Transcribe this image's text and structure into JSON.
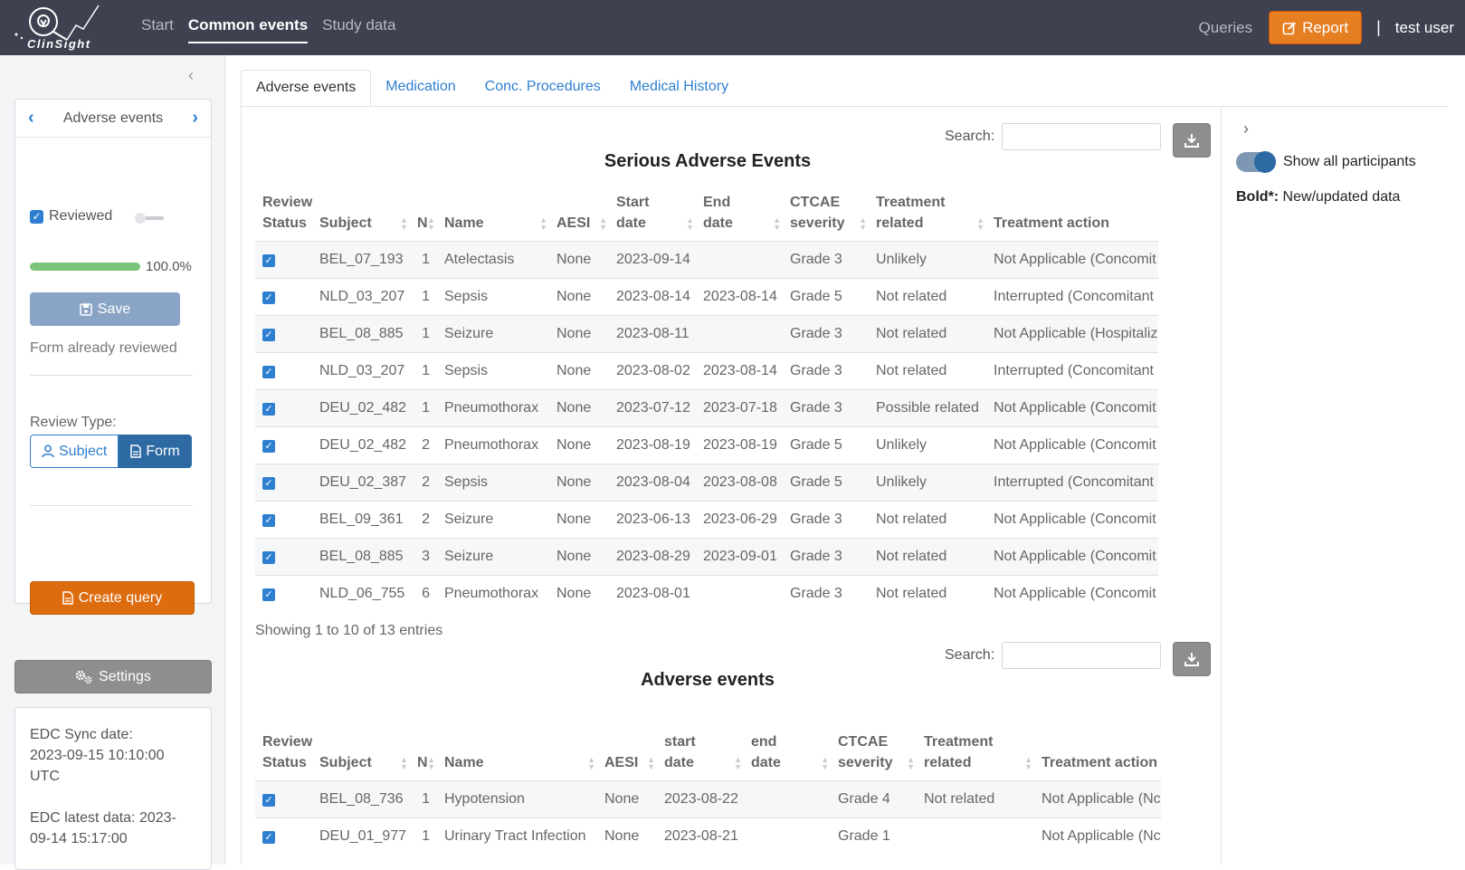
{
  "app": {
    "logo_text": "ClinSight"
  },
  "nav": {
    "links": [
      "Start",
      "Common events",
      "Study data"
    ],
    "active": "Common events",
    "queries": "Queries",
    "report": "Report",
    "separator": "|",
    "user": "test user"
  },
  "sidebar": {
    "form_name": "Adverse events",
    "reviewed_label": "Reviewed",
    "progress": 100,
    "progress_text": "100.0%",
    "save_label": "Save",
    "review_note": "Form already reviewed",
    "review_type_label": "Review Type:",
    "review_type_options": [
      "Subject",
      "Form"
    ],
    "review_type_selected": "Form",
    "create_query_label": "Create query",
    "settings_label": "Settings",
    "sync_date_label": "EDC Sync date:",
    "sync_date_value": "2023-09-15 10:10:00 UTC",
    "latest_data_label": "EDC latest data: 2023-",
    "latest_data_value": "09-14 15:17:00"
  },
  "tabs": [
    "Adverse events",
    "Medication",
    "Conc. Procedures",
    "Medical History"
  ],
  "right_panel": {
    "toggle_label": "Show all participants",
    "legend_bold": "Bold*:",
    "legend_text": " New/updated data"
  },
  "colors": {
    "navbar": "#3d4150",
    "accent": "#2f7fd0",
    "report": "#e67e22",
    "create_query": "#dd6c0f"
  },
  "sae_table": {
    "search_label": "Search:",
    "title": "Serious Adverse Events",
    "headers": [
      [
        "Review",
        "Status"
      ],
      [
        "",
        "Subject"
      ],
      [
        "",
        "N"
      ],
      [
        "",
        "Name"
      ],
      [
        "",
        "AESI"
      ],
      [
        "Start",
        "date"
      ],
      [
        "End",
        "date"
      ],
      [
        "CTCAE",
        "severity"
      ],
      [
        "Treatment",
        "related"
      ],
      [
        "",
        "Treatment action"
      ]
    ],
    "rows": [
      [
        "BEL_07_193",
        "1",
        "Atelectasis",
        "None",
        "2023-09-14",
        "",
        "Grade 3",
        "Unlikely",
        "Not Applicable (Concomit"
      ],
      [
        "NLD_03_207",
        "1",
        "Sepsis",
        "None",
        "2023-08-14",
        "2023-08-14",
        "Grade 5",
        "Not related",
        "Interrupted (Concomitant"
      ],
      [
        "BEL_08_885",
        "1",
        "Seizure",
        "None",
        "2023-08-11",
        "",
        "Grade 3",
        "Not related",
        "Not Applicable (Hospitaliz"
      ],
      [
        "NLD_03_207",
        "1",
        "Sepsis",
        "None",
        "2023-08-02",
        "2023-08-14",
        "Grade 3",
        "Not related",
        "Interrupted (Concomitant"
      ],
      [
        "DEU_02_482",
        "1",
        "Pneumothorax",
        "None",
        "2023-07-12",
        "2023-07-18",
        "Grade 3",
        "Possible related",
        "Not Applicable (Concomit"
      ],
      [
        "DEU_02_482",
        "2",
        "Pneumothorax",
        "None",
        "2023-08-19",
        "2023-08-19",
        "Grade 5",
        "Unlikely",
        "Not Applicable (Concomit"
      ],
      [
        "DEU_02_387",
        "2",
        "Sepsis",
        "None",
        "2023-08-04",
        "2023-08-08",
        "Grade 5",
        "Unlikely",
        "Interrupted (Concomitant"
      ],
      [
        "BEL_09_361",
        "2",
        "Seizure",
        "None",
        "2023-06-13",
        "2023-06-29",
        "Grade 3",
        "Not related",
        "Not Applicable (Concomit"
      ],
      [
        "BEL_08_885",
        "3",
        "Seizure",
        "None",
        "2023-08-29",
        "2023-09-01",
        "Grade 3",
        "Not related",
        "Not Applicable (Concomit"
      ],
      [
        "NLD_06_755",
        "6",
        "Pneumothorax",
        "None",
        "2023-08-01",
        "",
        "Grade 3",
        "Not related",
        "Not Applicable (Concomit"
      ]
    ],
    "info": "Showing 1 to 10 of 13 entries"
  },
  "ae_table": {
    "search_label": "Search:",
    "title": "Adverse events",
    "headers": [
      [
        "Review",
        "Status"
      ],
      [
        "",
        "Subject"
      ],
      [
        "",
        "N"
      ],
      [
        "",
        "Name"
      ],
      [
        "",
        "AESI"
      ],
      [
        "start",
        "date"
      ],
      [
        "end",
        "date"
      ],
      [
        "CTCAE",
        "severity"
      ],
      [
        "Treatment",
        "related"
      ],
      [
        "",
        "Treatment action"
      ]
    ],
    "rows": [
      [
        "BEL_08_736",
        "1",
        "Hypotension",
        "None",
        "2023-08-22",
        "",
        "Grade 4",
        "Not related",
        "Not Applicable (Nc"
      ],
      [
        "DEU_01_977",
        "1",
        "Urinary Tract Infection",
        "None",
        "2023-08-21",
        "",
        "Grade 1",
        "",
        "Not Applicable (Nc"
      ]
    ]
  }
}
